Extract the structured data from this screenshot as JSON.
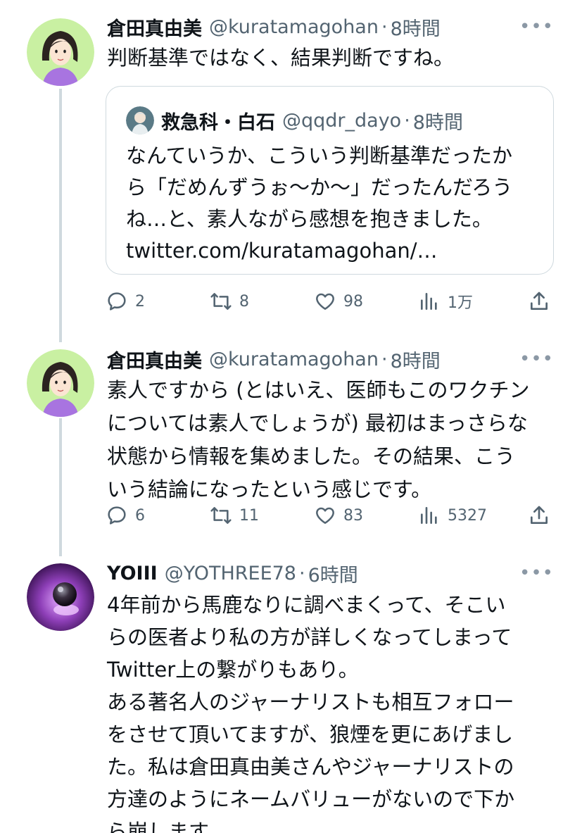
{
  "tweets": [
    {
      "name": "倉田真由美",
      "handle": "@kuratamagohan",
      "separator": "·",
      "time": "8時間",
      "more": "•••",
      "text_lines": [
        "判断基準ではなく、結果判断ですね。"
      ],
      "quote": {
        "name": "救急科・白石",
        "handle": "@qqdr_dayo",
        "separator": "·",
        "time": "8時間",
        "text_lines": [
          "なんていうか、こういう判断基準だったか",
          "ら「だめんずうぉ〜か〜」だったんだろう",
          "ね…と、素人ながら感想を抱きました。",
          "twitter.com/kuratamagohan/…"
        ]
      },
      "actions": {
        "replies": "2",
        "retweets": "8",
        "likes": "98",
        "views": "1万"
      }
    },
    {
      "name": "倉田真由美",
      "handle": "@kuratamagohan",
      "separator": "·",
      "time": "8時間",
      "more": "•••",
      "text_lines": [
        "素人ですから (とはいえ、医師もこのワクチン",
        "については素人でしょうが) 最初はまっさらな",
        "状態から情報を集めました。その結果、こう",
        "いう結論になったという感じです。"
      ],
      "actions": {
        "replies": "6",
        "retweets": "11",
        "likes": "83",
        "views": "5327"
      }
    },
    {
      "name": "YOIII",
      "handle": "@YOTHREE78",
      "separator": "·",
      "time": "6時間",
      "more": "•••",
      "text_lines": [
        "4年前から馬鹿なりに調べまくって、そこい",
        "らの医者より私の方が詳しくなってしまって",
        "Twitter上の繋がりもあり。",
        "ある著名人のジャーナリストも相互フォロー",
        "をさせて頂いてますが、狼煙を更にあげまし",
        "た。私は倉田真由美さんやジャーナリストの",
        "方達のようにネームバリューがないので下か",
        "ら崩します。"
      ]
    }
  ],
  "colors": {
    "text": "#0f1419",
    "secondary": "#536471",
    "border": "#cfd9de",
    "thread_line": "#cfd9de",
    "avatar_bg_green": "#c9f0a2",
    "avatar_bg_purple": "#8e3fb8"
  }
}
